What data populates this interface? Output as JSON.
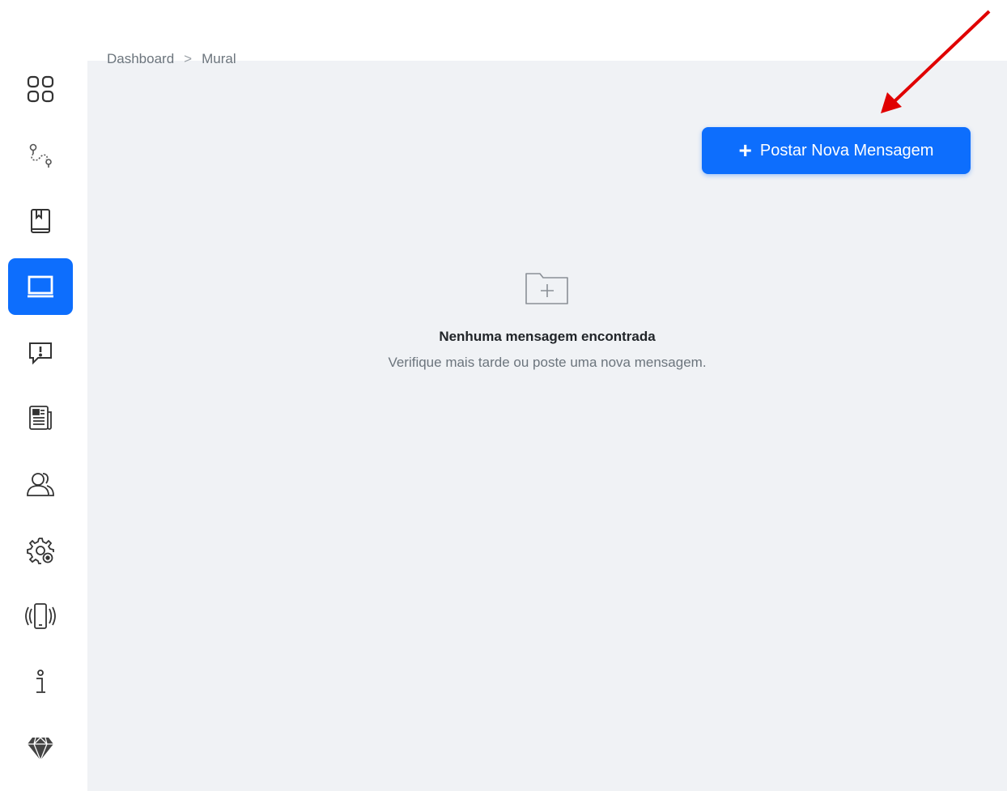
{
  "breadcrumb": {
    "items": [
      "Dashboard",
      "Mural"
    ],
    "separator": ">"
  },
  "sidebar": {
    "items": [
      {
        "icon": "grid-icon",
        "active": false
      },
      {
        "icon": "route-icon",
        "active": false
      },
      {
        "icon": "book-icon",
        "active": false
      },
      {
        "icon": "board-icon",
        "active": true
      },
      {
        "icon": "alert-message-icon",
        "active": false
      },
      {
        "icon": "newspaper-icon",
        "active": false
      },
      {
        "icon": "users-icon",
        "active": false
      },
      {
        "icon": "settings-icon",
        "active": false
      },
      {
        "icon": "phone-vibrate-icon",
        "active": false
      },
      {
        "icon": "info-icon",
        "active": false
      },
      {
        "icon": "diamond-icon",
        "active": false
      }
    ]
  },
  "toolbar": {
    "post_label": "Postar Nova Mensagem",
    "post_icon": "plus-icon"
  },
  "empty_state": {
    "icon": "folder-plus-icon",
    "title": "Nenhuma mensagem encontrada",
    "subtitle": "Verifique mais tarde ou poste uma nova mensagem."
  },
  "colors": {
    "accent": "#0d6efd",
    "background": "#f0f2f5",
    "annotation": "#e00000"
  }
}
